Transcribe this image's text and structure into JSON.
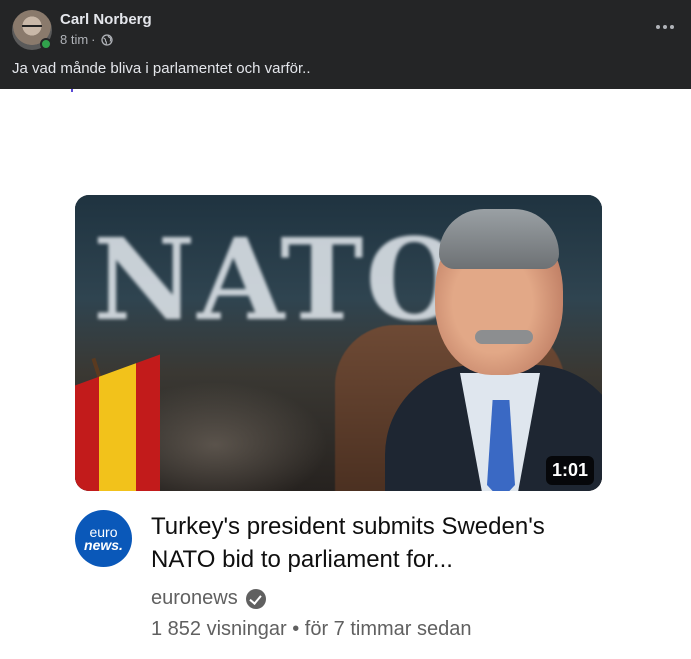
{
  "post": {
    "author": "Carl Norberg",
    "time": "8 tim",
    "separator": "·",
    "privacy_icon": "globe-icon",
    "text": "Ja vad månde bliva i parlamentet och varför.."
  },
  "video": {
    "thumbnail_text": "NATO",
    "duration": "1:01",
    "channel_logo_line1": "euro",
    "channel_logo_line2": "news.",
    "title": "Turkey's president submits Sweden's NATO bid to parliament for...",
    "channel": "euronews",
    "stats": "1 852 visningar • för 7 timmar sedan"
  },
  "colors": {
    "header_bg": "#242526",
    "online": "#31a24c",
    "euronews_blue": "#0a58b9"
  }
}
